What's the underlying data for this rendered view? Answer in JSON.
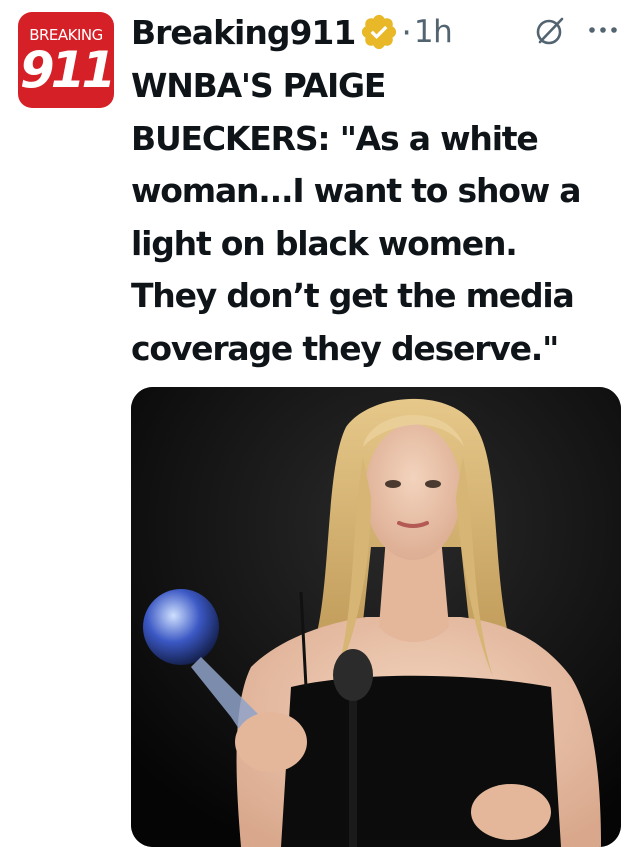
{
  "avatar": {
    "brand_top": "BREAKING",
    "brand_num": "911",
    "bg_color": "#d62027"
  },
  "header": {
    "display_name": "Breaking911",
    "verified_badge": "gold-verified-icon",
    "separator": "·",
    "time": "1h",
    "grok_icon": "grok-icon",
    "more_icon": "more-icon"
  },
  "tweet": {
    "lines": [
      "WNBA'S PAIGE",
      "BUECKERS: \"As a white",
      "woman...I want to show a",
      "light on black women.",
      "They don’t get the media",
      "coverage they deserve.\""
    ]
  },
  "media": {
    "kind": "photo"
  },
  "colors": {
    "text": "#0f1419",
    "secondary": "#536471",
    "verified_gold": "#e8b829"
  }
}
